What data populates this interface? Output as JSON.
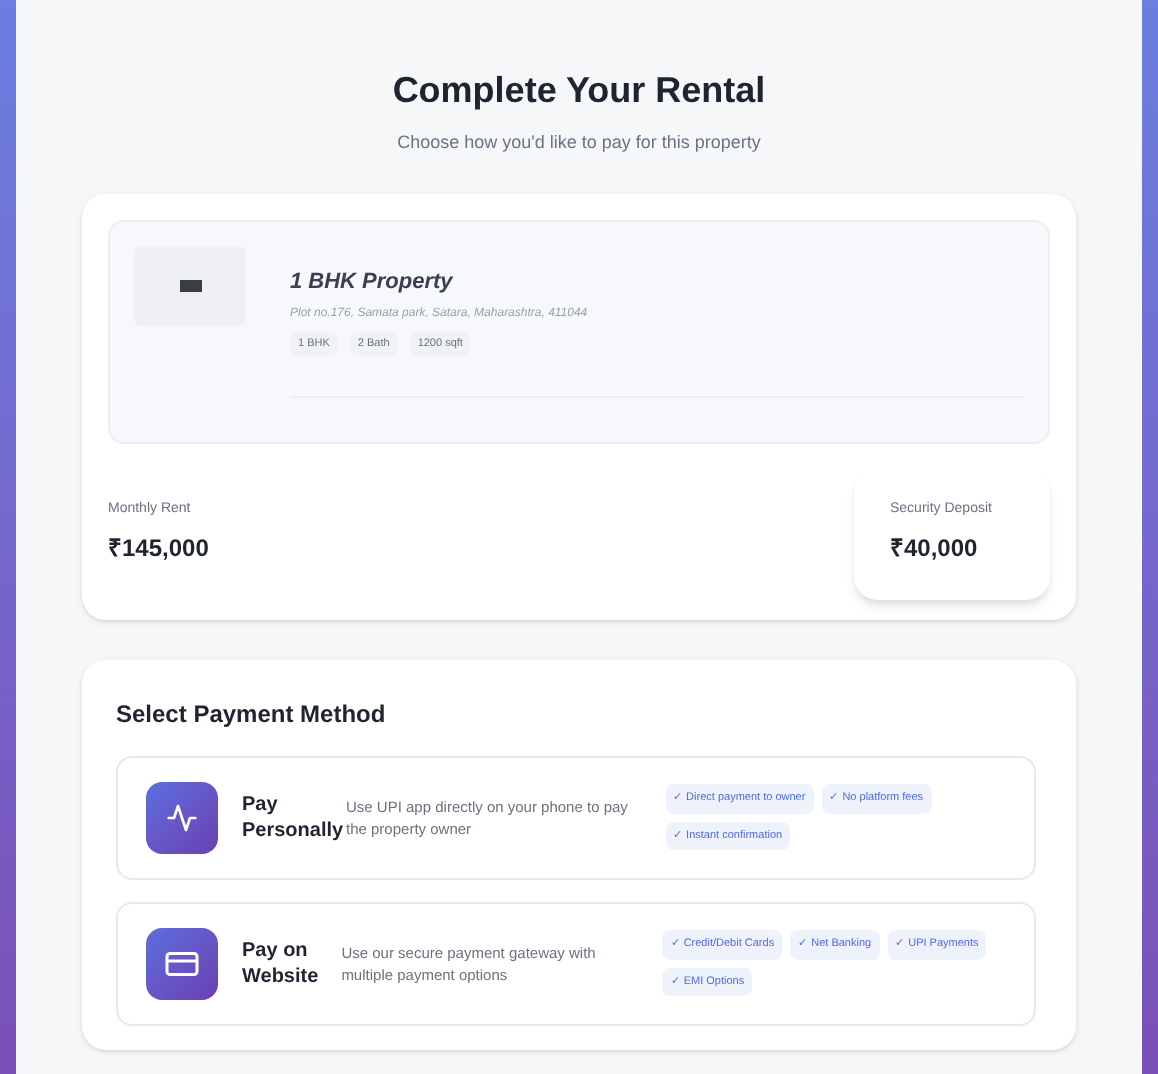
{
  "header": {
    "title": "Complete Your Rental",
    "subtitle": "Choose how you'd like to pay for this property"
  },
  "property": {
    "name": "1 BHK Property",
    "address": "Plot no.176, Samata park, Satara, Maharashtra, 411044",
    "tags": [
      "1 BHK",
      "2 Bath",
      "1200 sqft"
    ]
  },
  "rent": {
    "label": "Monthly Rent",
    "value": "₹145,000"
  },
  "deposit": {
    "label": "Security Deposit",
    "value": "₹40,000"
  },
  "payment": {
    "title": "Select Payment Method",
    "methods": [
      {
        "kind": "personal",
        "name": "Pay Personally",
        "description": "Use UPI app directly on your phone to pay the property owner",
        "features": [
          "✓ Direct payment to owner",
          "✓ No platform fees",
          "✓ Instant confirmation"
        ]
      },
      {
        "kind": "website",
        "name": "Pay on Website",
        "description": "Use our secure payment gateway with multiple payment options",
        "features": [
          "✓ Credit/Debit Cards",
          "✓ Net Banking",
          "✓ UPI Payments",
          "✓ EMI Options"
        ]
      }
    ]
  }
}
